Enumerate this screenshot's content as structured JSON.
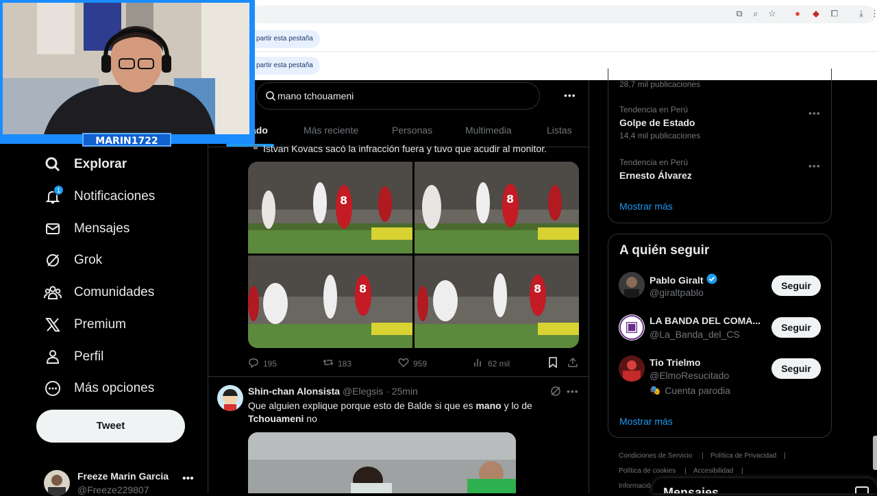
{
  "browser": {
    "share_chip_1": "partir esta pestaña",
    "share_chip_2": "partir esta pestaña"
  },
  "webcam": {
    "overlay_name": "MARIN1722"
  },
  "sidebar": {
    "items": [
      {
        "label": "Explorar",
        "icon": "search-icon"
      },
      {
        "label": "Notificaciones",
        "icon": "bell-icon",
        "badge": "1"
      },
      {
        "label": "Mensajes",
        "icon": "mail-icon"
      },
      {
        "label": "Grok",
        "icon": "grok-icon"
      },
      {
        "label": "Comunidades",
        "icon": "communities-icon"
      },
      {
        "label": "Premium",
        "icon": "x-logo-icon"
      },
      {
        "label": "Perfil",
        "icon": "person-icon"
      },
      {
        "label": "Más opciones",
        "icon": "more-circle-icon"
      }
    ],
    "tweet_button": "Tweet",
    "account": {
      "name": "Freeze Marin Garcia",
      "handle": "@Freeze229807"
    }
  },
  "search": {
    "query": "mano tchouameni"
  },
  "tabs": [
    "ado",
    "Más reciente",
    "Personas",
    "Multimedia",
    "Listas"
  ],
  "tweet1": {
    "partial_text": "Istvan Kovacs sacó la infracción fuera y tuvo que acudir al monitor.",
    "replies": "195",
    "retweets": "183",
    "likes": "959",
    "views": "62 mil"
  },
  "tweet2": {
    "name": "Shin-chan Alonsista",
    "handle": "@Elegsis",
    "time": "· 25min",
    "text_1": "Que alguien explique porque esto de Balde si que es ",
    "text_bold_1": "mano",
    "text_2": " y lo de",
    "text_bold_2": "Tchouameni",
    "text_3": " no"
  },
  "trends": {
    "top_count": "28,7 mil publicaciones",
    "items": [
      {
        "context": "Tendencia en Perú",
        "title": "Golpe de Estado",
        "count": "14,4 mil publicaciones"
      },
      {
        "context": "Tendencia en Perú",
        "title": "Ernesto Álvarez",
        "count": ""
      }
    ],
    "show_more": "Mostrar más"
  },
  "who_to_follow": {
    "title": "A quién seguir",
    "people": [
      {
        "name": "Pablo Giralt",
        "handle": "@giraltpablo",
        "verified": true,
        "button": "Seguir"
      },
      {
        "name": "LA BANDA DEL COMA...",
        "handle": "@La_Banda_del_CS",
        "verified": false,
        "button": "Seguir"
      },
      {
        "name": "Tio Trielmo",
        "handle": "@ElmoResucitado",
        "verified": false,
        "button": "Seguir",
        "extra": "Cuenta parodia"
      }
    ],
    "show_more": "Mostrar más"
  },
  "footer": {
    "links": [
      "Condiciones de Servicio",
      "Política de Privacidad",
      "Política de cookies",
      "Accesibilidad",
      "Informació"
    ]
  },
  "messages_drawer": {
    "title": "Mensajes"
  },
  "colors": {
    "accent": "#1d9bf0",
    "background": "#000000",
    "border": "#2f3336",
    "muted": "#71767b"
  }
}
